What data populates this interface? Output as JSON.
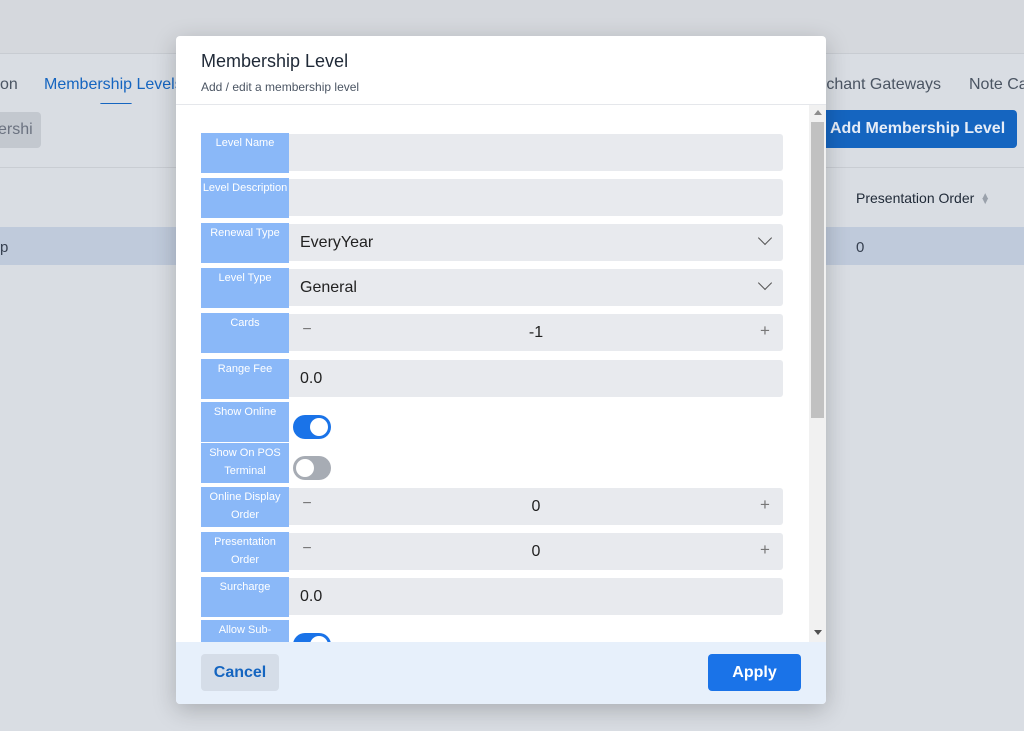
{
  "background": {
    "tabs": [
      {
        "label": "on"
      },
      {
        "label": "Membership Levels"
      },
      {
        "label": "rchant Gateways"
      },
      {
        "label": "Note Ca"
      }
    ],
    "search_placeholder": "ershi",
    "add_button_label": "Add Membership Level",
    "table": {
      "header_presentation_order": "Presentation Order",
      "row_left_cell": "p",
      "row_presentation_order": "0"
    }
  },
  "modal": {
    "title": "Membership Level",
    "subtitle": "Add / edit a membership level",
    "fields": {
      "level_name": {
        "label": "Level Name",
        "value": ""
      },
      "level_description": {
        "label": "Level Description",
        "value": ""
      },
      "renewal_type": {
        "label": "Renewal Type",
        "value": "EveryYear"
      },
      "level_type": {
        "label": "Level Type",
        "value": "General"
      },
      "cards": {
        "label": "Cards",
        "value": "-1",
        "minus": "−",
        "plus": "+"
      },
      "range_fee": {
        "label": "Range Fee",
        "value": "0.0"
      },
      "show_online": {
        "label": "Show Online",
        "checked": true
      },
      "show_on_pos_terminal": {
        "label": "Show On POS Terminal",
        "checked": false
      },
      "online_display_order": {
        "label": "Online Display Order",
        "value": "0",
        "minus": "−",
        "plus": "+"
      },
      "presentation_order": {
        "label": "Presentation Order",
        "value": "0",
        "minus": "−",
        "plus": "+"
      },
      "surcharge": {
        "label": "Surcharge",
        "value": "0.0"
      },
      "allow_sub": {
        "label": "Allow Sub-",
        "checked": true
      }
    },
    "footer": {
      "cancel_label": "Cancel",
      "apply_label": "Apply"
    }
  },
  "colors": {
    "accent": "#1a73e8",
    "label_bg": "#8ab8f8",
    "field_bg": "#e8eaee",
    "footer_bg": "#e7f0fb"
  }
}
